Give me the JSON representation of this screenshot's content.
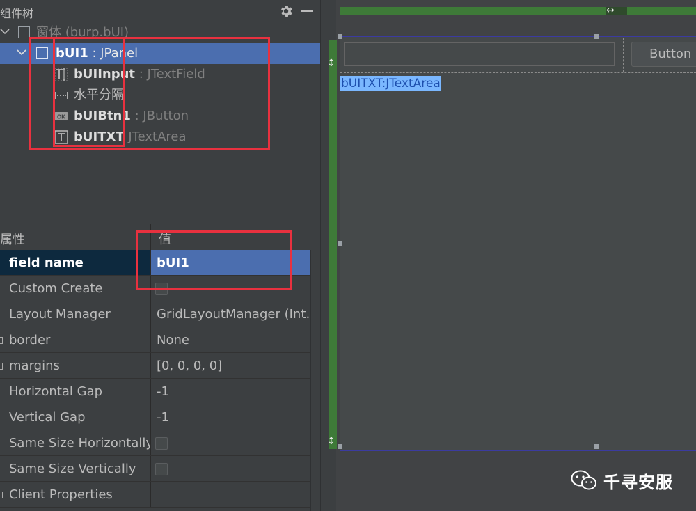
{
  "tree": {
    "title": "组件树",
    "root": {
      "name": "窗体",
      "type": "(burp.bUI)"
    },
    "selected": {
      "name": "bUI1",
      "sep": " : ",
      "type": "JPanel"
    },
    "children": [
      {
        "name": "bUIInput",
        "sep": " : ",
        "type": "JTextField",
        "icon": "text-field-icon"
      },
      {
        "name": "水平分隔",
        "sep": "",
        "type": "",
        "icon": "horizontal-spacer-icon"
      },
      {
        "name": "bUIBtn1",
        "sep": " : ",
        "type": "JButton",
        "icon": "button-icon"
      },
      {
        "name": "bUITXT",
        "sep": " ",
        "type": "JTextArea",
        "icon": "text-area-icon"
      }
    ]
  },
  "props": {
    "header_name": "属性",
    "header_value": "值",
    "rows": [
      {
        "name": "field name",
        "value": "bUI1",
        "selected": true
      },
      {
        "name": "Custom Create",
        "value": "",
        "checkbox": true
      },
      {
        "name": "Layout Manager",
        "value": "GridLayoutManager (Int…"
      },
      {
        "name": "border",
        "value": "None",
        "expand": true
      },
      {
        "name": "margins",
        "value": "[0, 0, 0, 0]",
        "expand": true
      },
      {
        "name": "Horizontal Gap",
        "value": "-1"
      },
      {
        "name": "Vertical Gap",
        "value": "-1"
      },
      {
        "name": "Same Size Horizontally",
        "value": "",
        "checkbox": true
      },
      {
        "name": "Same Size Vertically",
        "value": "",
        "checkbox": true
      },
      {
        "name": "Client Properties",
        "value": "",
        "expand": true
      }
    ]
  },
  "designer": {
    "button_label": "Button",
    "textarea_label": "bUITXT:JTextArea"
  },
  "watermark": {
    "text": "千寻安服"
  },
  "colors": {
    "selection": "#4b6eaf",
    "highlight_box": "#e8313f",
    "grid_bar": "#3e7a38"
  }
}
